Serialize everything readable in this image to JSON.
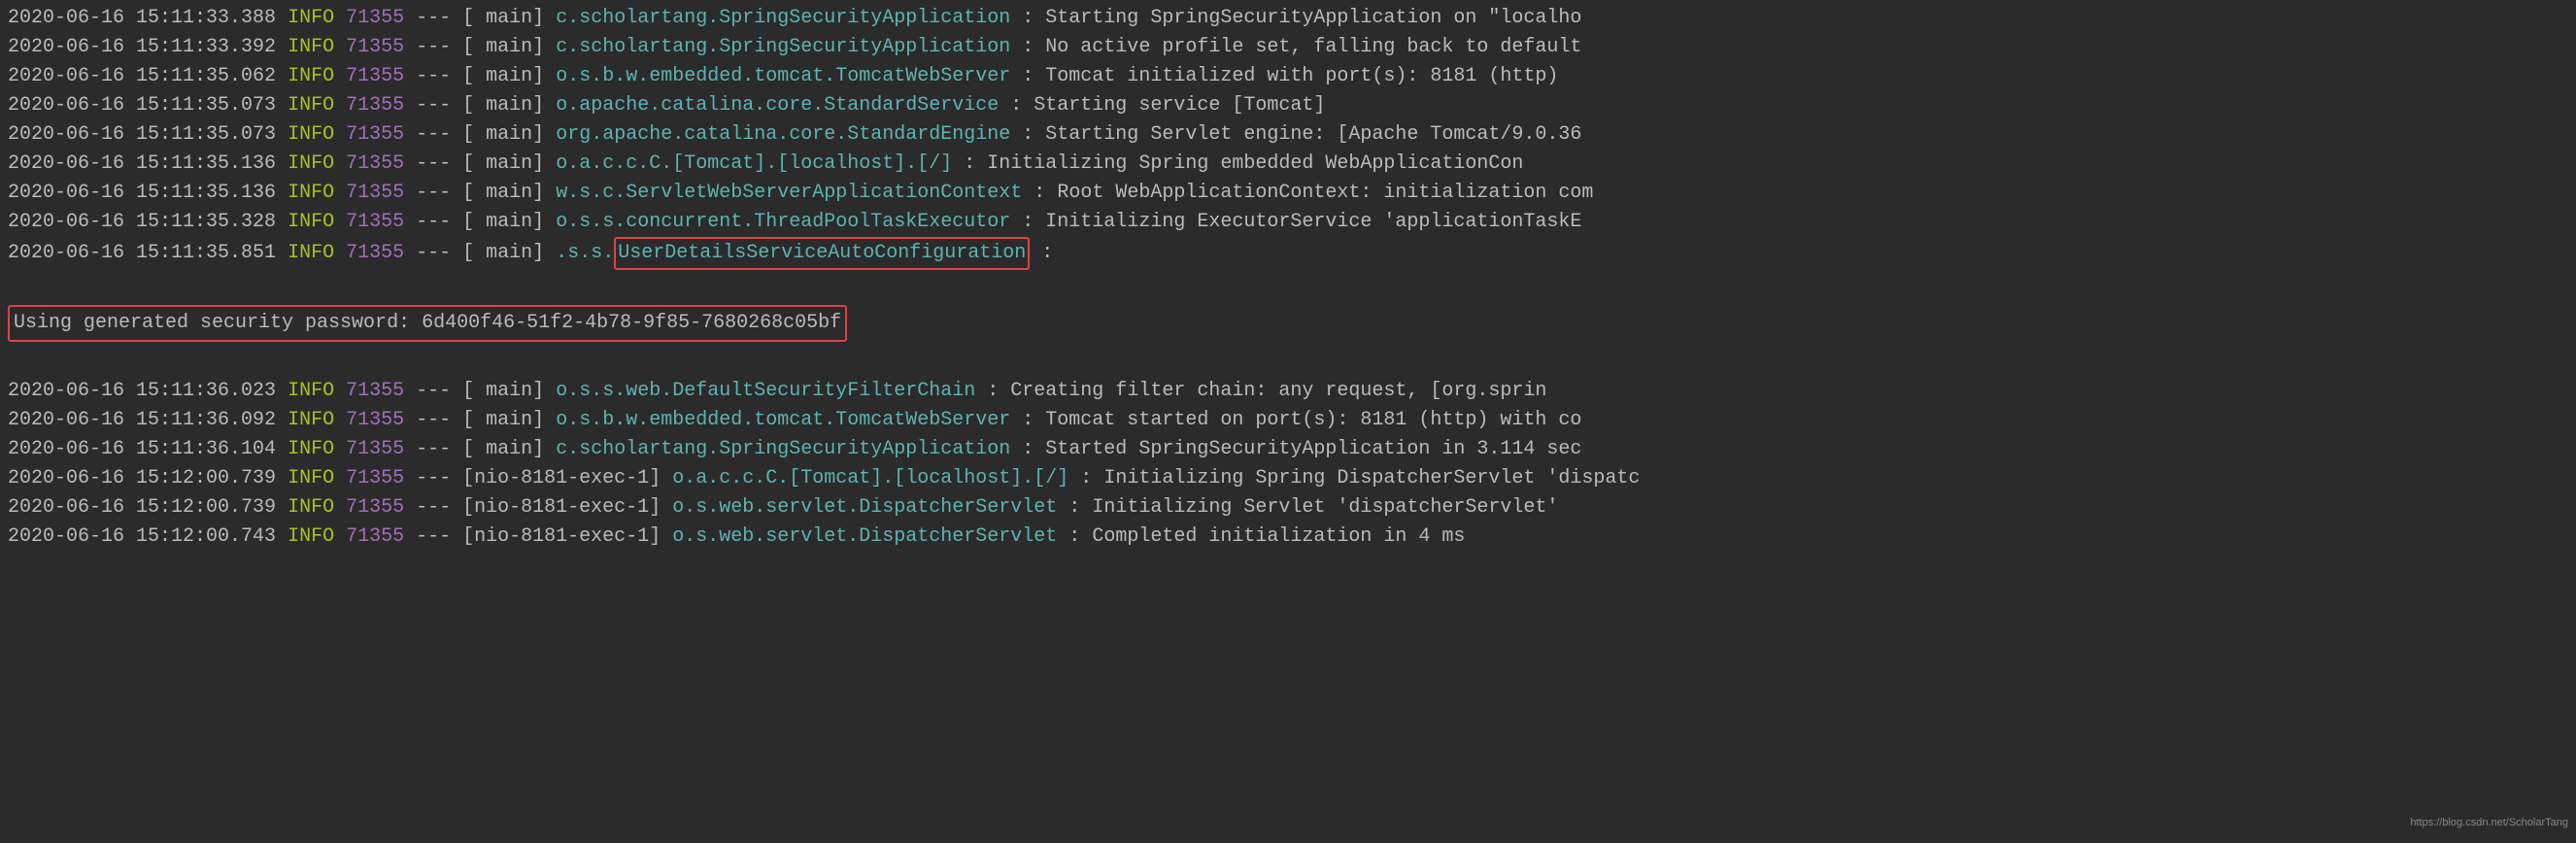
{
  "lines": [
    {
      "ts": "2020-06-16 15:11:33.388",
      "level": "INFO",
      "pid": "71355",
      "dashes": "---",
      "thread_open": "[",
      "thread_close": "main]",
      "logger": "c.scholartang.SpringSecurityApplication",
      "sep": ":",
      "msg": "Starting SpringSecurityApplication on \"localho",
      "hl": false
    },
    {
      "ts": "2020-06-16 15:11:33.392",
      "level": "INFO",
      "pid": "71355",
      "dashes": "---",
      "thread_open": "[",
      "thread_close": "main]",
      "logger": "c.scholartang.SpringSecurityApplication",
      "sep": ":",
      "msg": "No active profile set, falling back to default",
      "hl": false
    },
    {
      "ts": "2020-06-16 15:11:35.062",
      "level": "INFO",
      "pid": "71355",
      "dashes": "---",
      "thread_open": "[",
      "thread_close": "main]",
      "logger": "o.s.b.w.embedded.tomcat.TomcatWebServer",
      "sep": ":",
      "msg": "Tomcat initialized with port(s): 8181 (http)",
      "hl": false
    },
    {
      "ts": "2020-06-16 15:11:35.073",
      "level": "INFO",
      "pid": "71355",
      "dashes": "---",
      "thread_open": "[",
      "thread_close": "main]",
      "logger": "o.apache.catalina.core.StandardService",
      "sep": ":",
      "msg": "Starting service [Tomcat]",
      "hl": false
    },
    {
      "ts": "2020-06-16 15:11:35.073",
      "level": "INFO",
      "pid": "71355",
      "dashes": "---",
      "thread_open": "[",
      "thread_close": "main]",
      "logger": "org.apache.catalina.core.StandardEngine",
      "sep": ":",
      "msg": "Starting Servlet engine: [Apache Tomcat/9.0.36",
      "hl": false
    },
    {
      "ts": "2020-06-16 15:11:35.136",
      "level": "INFO",
      "pid": "71355",
      "dashes": "---",
      "thread_open": "[",
      "thread_close": "main]",
      "logger": "o.a.c.c.C.[Tomcat].[localhost].[/]",
      "sep": ":",
      "msg": "Initializing Spring embedded WebApplicationCon",
      "hl": false
    },
    {
      "ts": "2020-06-16 15:11:35.136",
      "level": "INFO",
      "pid": "71355",
      "dashes": "---",
      "thread_open": "[",
      "thread_close": "main]",
      "logger": "w.s.c.ServletWebServerApplicationContext",
      "sep": ":",
      "msg": "Root WebApplicationContext: initialization com",
      "hl": false
    },
    {
      "ts": "2020-06-16 15:11:35.328",
      "level": "INFO",
      "pid": "71355",
      "dashes": "---",
      "thread_open": "[",
      "thread_close": "main]",
      "logger": "o.s.s.concurrent.ThreadPoolTaskExecutor",
      "sep": ":",
      "msg": "Initializing ExecutorService 'applicationTaskE",
      "hl": false
    },
    {
      "ts": "2020-06-16 15:11:35.851",
      "level": "INFO",
      "pid": "71355",
      "dashes": "---",
      "thread_open": "[",
      "thread_close": "main]",
      "logger_prefix": ".s.s.",
      "logger_hl": "UserDetailsServiceAutoConfiguration",
      "sep": ":",
      "msg": "",
      "hl": true
    }
  ],
  "password_line": "Using generated security password: 6d400f46-51f2-4b78-9f85-7680268c05bf",
  "lines2": [
    {
      "ts": "2020-06-16 15:11:36.023",
      "level": "INFO",
      "pid": "71355",
      "dashes": "---",
      "thread_open": "[",
      "thread_close": "main]",
      "logger": "o.s.s.web.DefaultSecurityFilterChain",
      "sep": ":",
      "msg": "Creating filter chain: any request, [org.sprin",
      "hl": false
    },
    {
      "ts": "2020-06-16 15:11:36.092",
      "level": "INFO",
      "pid": "71355",
      "dashes": "---",
      "thread_open": "[",
      "thread_close": "main]",
      "logger": "o.s.b.w.embedded.tomcat.TomcatWebServer",
      "sep": ":",
      "msg": "Tomcat started on port(s): 8181 (http) with co",
      "hl": false
    },
    {
      "ts": "2020-06-16 15:11:36.104",
      "level": "INFO",
      "pid": "71355",
      "dashes": "---",
      "thread_open": "[",
      "thread_close": "main]",
      "logger": "c.scholartang.SpringSecurityApplication",
      "sep": ":",
      "msg": "Started SpringSecurityApplication in 3.114 sec",
      "hl": false
    },
    {
      "ts": "2020-06-16 15:12:00.739",
      "level": "INFO",
      "pid": "71355",
      "dashes": "---",
      "thread_open": "[nio-8181-exec-1]",
      "thread_close": "",
      "logger": "o.a.c.c.C.[Tomcat].[localhost].[/]",
      "sep": ":",
      "msg": "Initializing Spring DispatcherServlet 'dispatc",
      "hl": false
    },
    {
      "ts": "2020-06-16 15:12:00.739",
      "level": "INFO",
      "pid": "71355",
      "dashes": "---",
      "thread_open": "[nio-8181-exec-1]",
      "thread_close": "",
      "logger": "o.s.web.servlet.DispatcherServlet",
      "sep": ":",
      "msg": "Initializing Servlet 'dispatcherServlet'",
      "hl": false
    },
    {
      "ts": "2020-06-16 15:12:00.743",
      "level": "INFO",
      "pid": "71355",
      "dashes": "---",
      "thread_open": "[nio-8181-exec-1]",
      "thread_close": "",
      "logger": "o.s.web.servlet.DispatcherServlet",
      "sep": ":",
      "msg": "Completed initialization in 4 ms",
      "hl": false
    }
  ],
  "watermark": "https://blog.csdn.net/ScholarTang"
}
